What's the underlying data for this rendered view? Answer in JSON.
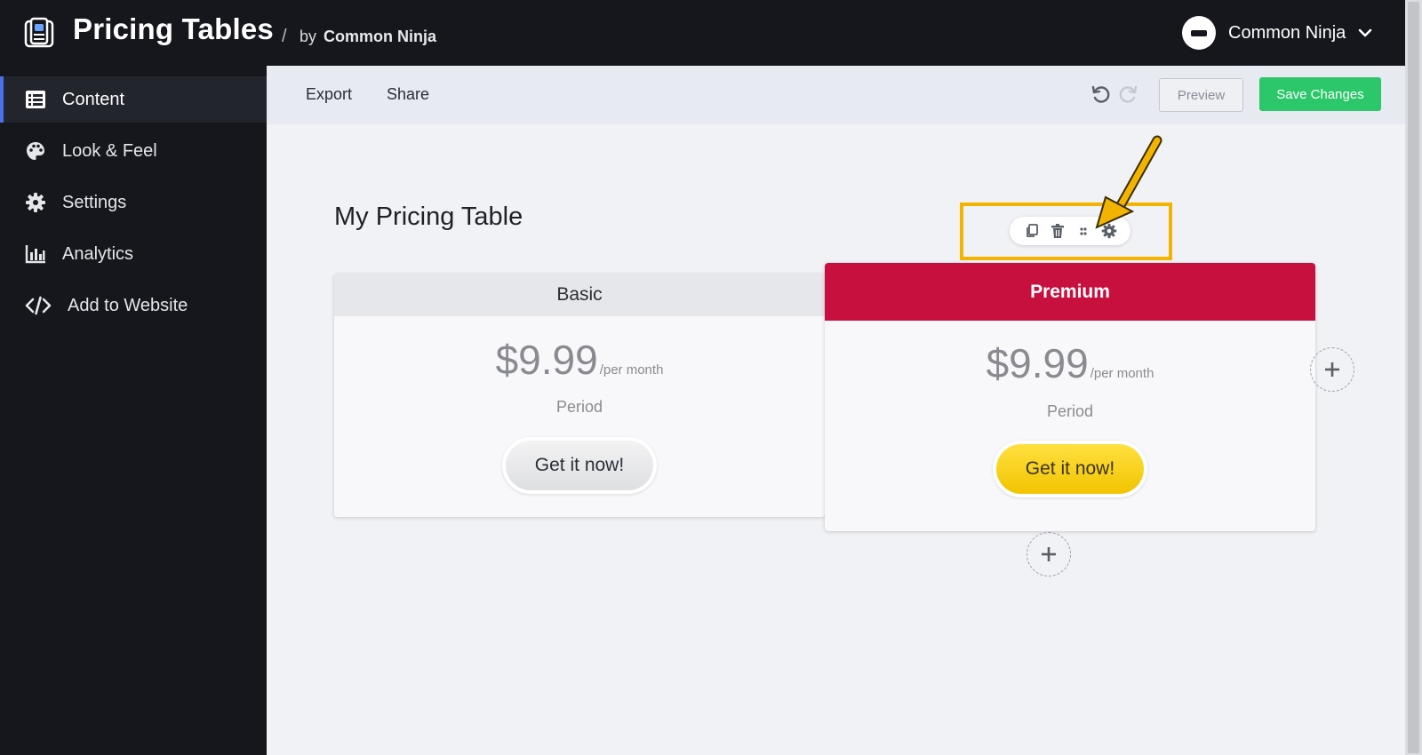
{
  "header": {
    "app_title": "Pricing Tables",
    "separator": "/",
    "by_label": "by",
    "brand": "Common Ninja",
    "user_name": "Common Ninja"
  },
  "sidebar": {
    "items": [
      {
        "label": "Content",
        "icon": "list-icon",
        "active": true
      },
      {
        "label": "Look & Feel",
        "icon": "palette-icon",
        "active": false
      },
      {
        "label": "Settings",
        "icon": "gear-icon",
        "active": false
      },
      {
        "label": "Analytics",
        "icon": "bar-chart-icon",
        "active": false
      },
      {
        "label": "Add to Website",
        "icon": "code-icon",
        "active": false
      }
    ]
  },
  "toolbar": {
    "export_label": "Export",
    "share_label": "Share",
    "preview_label": "Preview",
    "save_label": "Save Changes"
  },
  "editor": {
    "table_title": "My Pricing Table",
    "column_toolbar_icons": [
      "copy-icon",
      "trash-icon",
      "drag-handle-icon",
      "gear-icon"
    ]
  },
  "plans": [
    {
      "name": "Basic",
      "price": "$9.99",
      "per": "/per month",
      "period": "Period",
      "cta": "Get it now!",
      "header_color": "#e6e7ea",
      "button_color": "#e4e4e6"
    },
    {
      "name": "Premium",
      "price": "$9.99",
      "per": "/per month",
      "period": "Period",
      "cta": "Get it now!",
      "header_color": "#c8103f",
      "button_color": "#f7d117"
    }
  ],
  "colors": {
    "accent_green": "#2cc76a",
    "highlight": "#f2b400",
    "sidebar_bg": "#15171c",
    "active_indicator": "#4a72e8"
  }
}
